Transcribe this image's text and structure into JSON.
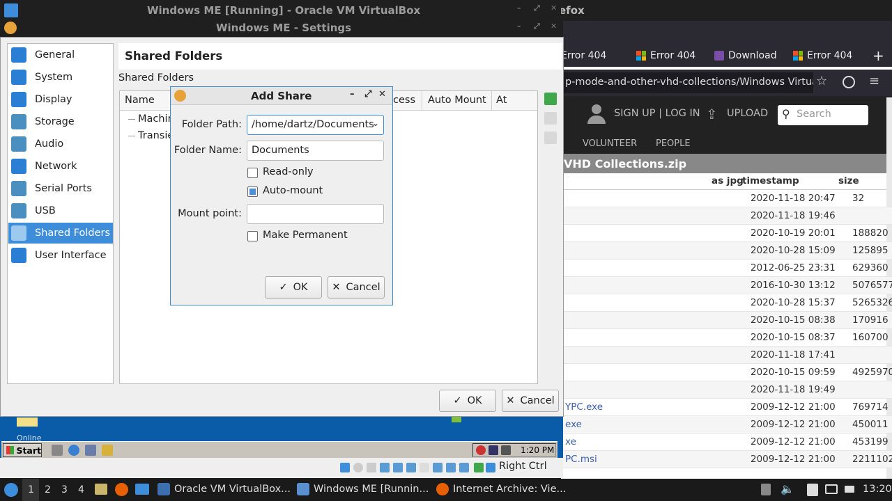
{
  "firefox": {
    "title_fragment": "efox",
    "tabs": [
      {
        "label": "Error 404",
        "icon": "windows-logo-icon"
      },
      {
        "label": "Error 404",
        "icon": "windows-logo-icon"
      },
      {
        "label": "Download",
        "icon": "archive-icon"
      },
      {
        "label": "Error 404",
        "icon": "windows-logo-icon"
      }
    ],
    "new_tab_glyph": "+",
    "url": "p-mode-and-other-vhd-collections/Windows Virtua",
    "archive": {
      "signup_label": "SIGN UP | LOG IN",
      "upload_label": "UPLOAD",
      "search_placeholder": "Search",
      "nav": [
        "VOLUNTEER",
        "PEOPLE"
      ],
      "title": "VHD Collections.zip",
      "col_asjpg": "as jpg",
      "col_timestamp": "timestamp",
      "col_size": "size",
      "rows": [
        {
          "name": "",
          "timestamp": "2020-11-18 20:47",
          "size": "32"
        },
        {
          "name": "",
          "timestamp": "2020-11-18 19:46",
          "size": ""
        },
        {
          "name": "",
          "timestamp": "2020-10-19 20:01",
          "size": "188820"
        },
        {
          "name": "",
          "timestamp": "2020-10-28 15:09",
          "size": "125895"
        },
        {
          "name": "",
          "timestamp": "2012-06-25 23:31",
          "size": "629360"
        },
        {
          "name": "",
          "timestamp": "2016-10-30 13:12",
          "size": "5076577"
        },
        {
          "name": "",
          "timestamp": "2020-10-28 15:37",
          "size": "5265326"
        },
        {
          "name": "",
          "timestamp": "2020-10-15 08:38",
          "size": "170916"
        },
        {
          "name": "",
          "timestamp": "2020-10-15 08:37",
          "size": "160700"
        },
        {
          "name": "",
          "timestamp": "2020-11-18 17:41",
          "size": ""
        },
        {
          "name": "",
          "timestamp": "2020-10-15 09:59",
          "size": "4925970"
        },
        {
          "name": "",
          "timestamp": "2020-11-18 19:49",
          "size": ""
        },
        {
          "name": "YPC.exe",
          "timestamp": "2009-12-12 21:00",
          "size": "769714"
        },
        {
          "name": "exe",
          "timestamp": "2009-12-12 21:00",
          "size": "450011"
        },
        {
          "name": "xe",
          "timestamp": "2009-12-12 21:00",
          "size": "453199"
        },
        {
          "name": "PC.msi",
          "timestamp": "2009-12-12 21:00",
          "size": "2211102"
        }
      ]
    }
  },
  "vbox": {
    "main_title": "Windows ME [Running] - Oracle VM VirtualBox",
    "settings_title": "Windows ME - Settings",
    "sidebar": [
      {
        "label": "General",
        "icon": "general-icon",
        "color": "#2a7fd4"
      },
      {
        "label": "System",
        "icon": "system-icon",
        "color": "#2a7fd4"
      },
      {
        "label": "Display",
        "icon": "display-icon",
        "color": "#2a7fd4"
      },
      {
        "label": "Storage",
        "icon": "storage-icon",
        "color": "#4a8fc0"
      },
      {
        "label": "Audio",
        "icon": "audio-icon",
        "color": "#4a8fc0"
      },
      {
        "label": "Network",
        "icon": "network-icon",
        "color": "#2a7fd4"
      },
      {
        "label": "Serial Ports",
        "icon": "serial-ports-icon",
        "color": "#4a8fc0"
      },
      {
        "label": "USB",
        "icon": "usb-icon",
        "color": "#4a8fc0"
      },
      {
        "label": "Shared Folders",
        "icon": "shared-folders-icon",
        "color": "#9ec9ef"
      },
      {
        "label": "User Interface",
        "icon": "user-interface-icon",
        "color": "#2a7fd4"
      }
    ],
    "selected_index": 8,
    "page_title": "Shared Folders",
    "section_label": "Shared Folders",
    "columns": [
      "Name",
      "cess",
      "Auto Mount",
      "At"
    ],
    "tree": [
      "Machin",
      "Transie"
    ],
    "ok_label": "OK",
    "cancel_label": "Cancel",
    "status_host_key": "Right Ctrl"
  },
  "guest": {
    "desktop_label": "Online",
    "start_label": "Start",
    "clock": "1:20 PM"
  },
  "dialog": {
    "title": "Add Share",
    "folder_path_label": "Folder Path:",
    "folder_path_value": "/home/dartz/Documents",
    "folder_name_label": "Folder Name:",
    "folder_name_value": "Documents",
    "readonly_label": "Read-only",
    "readonly_checked": false,
    "automount_label": "Auto-mount",
    "automount_checked": true,
    "mount_point_label": "Mount point:",
    "mount_point_value": "",
    "permanent_label": "Make Permanent",
    "permanent_checked": false,
    "ok_label": "OK",
    "cancel_label": "Cancel"
  },
  "host_taskbar": {
    "workspaces": [
      "1",
      "2",
      "3",
      "4"
    ],
    "active_workspace": "1",
    "items": [
      {
        "label": "Oracle VM VirtualBox...",
        "icon": "virtualbox-icon"
      },
      {
        "label": "Windows ME [Runnin...",
        "icon": "windows-me-icon"
      },
      {
        "label": "Internet Archive: Vie...",
        "icon": "firefox-icon"
      }
    ],
    "clock": "13:20"
  },
  "colors": {
    "accent": "#3d8ddb",
    "guest_desktop": "#0a5ca8",
    "link": "#3a5fad"
  }
}
